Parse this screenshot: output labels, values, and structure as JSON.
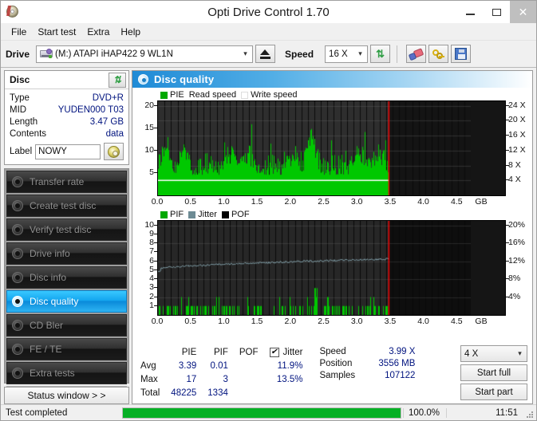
{
  "window": {
    "title": "Opti Drive Control 1.70",
    "icon": "disc-icon",
    "minimize": "–",
    "maximize": "□",
    "close": "✕"
  },
  "menu": [
    "File",
    "Start test",
    "Extra",
    "Help"
  ],
  "toolbar": {
    "drive_label": "Drive",
    "drive_value": "(M:)  ATAPI iHAP422  9 WL1N",
    "eject_title": "Eject",
    "speed_label": "Speed",
    "speed_value": "16 X",
    "refresh_icon": "refresh-icon",
    "eraser_icon": "eraser-icon",
    "keys_icon": "keys-icon",
    "save_icon": "save-icon"
  },
  "disc": {
    "title": "Disc",
    "refresh_icon": "refresh-icon",
    "rows": [
      {
        "key": "Type",
        "value": "DVD+R"
      },
      {
        "key": "MID",
        "value": "YUDEN000 T03"
      },
      {
        "key": "Length",
        "value": "3.47 GB"
      },
      {
        "key": "Contents",
        "value": "data"
      }
    ],
    "label_key": "Label",
    "label_value": "NOWY",
    "label_button_icon": "cd-icon"
  },
  "nav": {
    "items": [
      {
        "label": "Transfer rate",
        "active": false
      },
      {
        "label": "Create test disc",
        "active": false
      },
      {
        "label": "Verify test disc",
        "active": false
      },
      {
        "label": "Drive info",
        "active": false
      },
      {
        "label": "Disc info",
        "active": false
      },
      {
        "label": "Disc quality",
        "active": true
      },
      {
        "label": "CD Bler",
        "active": false
      },
      {
        "label": "FE / TE",
        "active": false
      },
      {
        "label": "Extra tests",
        "active": false
      }
    ],
    "status_window_button": "Status window > >"
  },
  "panel": {
    "title": "Disc quality",
    "icon": "disc-quality-icon"
  },
  "stats": {
    "columns": [
      "PIE",
      "PIF",
      "POF",
      "Jitter"
    ],
    "jitter_checkbox_checked": true,
    "jitter_check_glyph": "✔",
    "rows": [
      {
        "label": "Avg",
        "pie": "3.39",
        "pif": "0.01",
        "pof": "",
        "jitter": "11.9%"
      },
      {
        "label": "Max",
        "pie": "17",
        "pif": "3",
        "pof": "",
        "jitter": "13.5%"
      },
      {
        "label": "Total",
        "pie": "48225",
        "pif": "1334",
        "pof": "",
        "jitter": ""
      }
    ],
    "side": [
      {
        "key": "Speed",
        "value": "3.99 X"
      },
      {
        "key": "Position",
        "value": "3556 MB"
      },
      {
        "key": "Samples",
        "value": "107122"
      }
    ],
    "speed_select": "4 X",
    "start_full": "Start full",
    "start_part": "Start part"
  },
  "statusbar": {
    "text": "Test completed",
    "percent": "100.0%",
    "progress": 100,
    "time": "11:51"
  },
  "colors": {
    "pie_green": "#00c800",
    "pif_green": "#00c800",
    "jitter": "#6d8b94",
    "pof": "#000000",
    "read_speed": "#ffffff",
    "marker_red": "#ff0000",
    "accent_blue": "#1e8ad6",
    "value_text": "#00137f",
    "progress_green": "#06b025"
  },
  "chart_data": [
    {
      "type": "area",
      "name": "pie-chart",
      "title": "PIE / Read speed",
      "legend": [
        {
          "label": "PIE",
          "color": "#00a800",
          "swatch": true
        },
        {
          "label": "Read speed",
          "color": "#ffffff",
          "swatch": false
        },
        {
          "label": "Write speed",
          "color": "#ffffff",
          "swatch": true
        }
      ],
      "xlabel": "GB",
      "xlim": [
        0,
        4.7
      ],
      "xticks": [
        0.0,
        0.5,
        1.0,
        1.5,
        2.0,
        2.5,
        3.0,
        3.5,
        4.0,
        4.5
      ],
      "xticklabels": [
        "0.0",
        "0.5",
        "1.0",
        "1.5",
        "2.0",
        "2.5",
        "3.0",
        "3.5",
        "4.0",
        "4.5"
      ],
      "ylabel": "PIE",
      "ylim": [
        0,
        21
      ],
      "yticks": [
        5,
        10,
        15,
        20
      ],
      "yticklabels": [
        "5",
        "10",
        "15",
        "20"
      ],
      "y2label": "X",
      "y2lim": [
        0,
        25.2
      ],
      "y2ticks": [
        4,
        8,
        12,
        16,
        20,
        24
      ],
      "y2ticklabels": [
        "4 X",
        "8 X",
        "12 X",
        "16 X",
        "20 X",
        "24 X"
      ],
      "grid": true,
      "data_end_x": 3.47,
      "marker_x": 3.47,
      "series": [
        {
          "name": "PIE",
          "kind": "bars",
          "color": "#00c800",
          "baseline": 0,
          "mean": 3.39,
          "max": 17,
          "band_low": 5,
          "band_high": 10
        },
        {
          "name": "Read speed",
          "kind": "line",
          "color": "#ffffff",
          "value_x": 3.99,
          "flat": true
        }
      ]
    },
    {
      "type": "area",
      "name": "pif-jitter-chart",
      "title": "PIF / Jitter / POF",
      "legend": [
        {
          "label": "PIF",
          "color": "#00a800",
          "swatch": true
        },
        {
          "label": "Jitter",
          "color": "#6d8b94",
          "swatch": true
        },
        {
          "label": "POF",
          "color": "#000000",
          "swatch": true
        }
      ],
      "xlabel": "GB",
      "xlim": [
        0,
        4.7
      ],
      "xticks": [
        0.0,
        0.5,
        1.0,
        1.5,
        2.0,
        2.5,
        3.0,
        3.5,
        4.0,
        4.5
      ],
      "xticklabels": [
        "0.0",
        "0.5",
        "1.0",
        "1.5",
        "2.0",
        "2.5",
        "3.0",
        "3.5",
        "4.0",
        "4.5"
      ],
      "ylabel": "PIF",
      "ylim": [
        0,
        10.5
      ],
      "yticks": [
        1,
        2,
        3,
        4,
        5,
        6,
        7,
        8,
        9,
        10
      ],
      "yticklabels": [
        "1",
        "2",
        "3",
        "4",
        "5",
        "6",
        "7",
        "8",
        "9",
        "10"
      ],
      "y2label": "%",
      "y2lim": [
        0,
        21
      ],
      "y2ticks": [
        4,
        8,
        12,
        16,
        20
      ],
      "y2ticklabels": [
        "4%",
        "8%",
        "12%",
        "16%",
        "20%"
      ],
      "grid": true,
      "data_end_x": 3.47,
      "marker_x": 3.47,
      "series": [
        {
          "name": "PIF",
          "kind": "bars",
          "color": "#00c800",
          "mean": 0.01,
          "max": 3
        },
        {
          "name": "Jitter",
          "kind": "line",
          "color": "#7d9aa3",
          "start_pct": 10.3,
          "end_pct": 12.5,
          "avg_pct": 11.9,
          "max_pct": 13.5
        }
      ]
    }
  ]
}
